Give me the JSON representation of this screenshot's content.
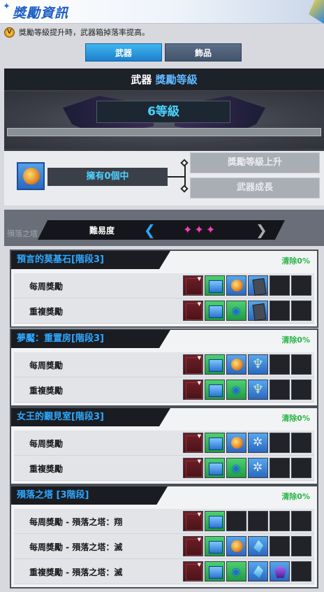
{
  "header": {
    "title": "獎勵資訊",
    "star_icon": "sparkle-icon"
  },
  "notice": {
    "text": "獎勵等級提升時，武器箱掉落率提高。",
    "icon": "medal-icon"
  },
  "tabs": [
    {
      "label": "武器",
      "active": true
    },
    {
      "label": "飾品",
      "active": false
    }
  ],
  "grade": {
    "head_prefix": "武器",
    "head_highlight": "獎勵等級",
    "level": "6等級",
    "progress": 0,
    "owned": "擁有0個中",
    "upgrade_button": "獎勵等級上升",
    "growth_button": "武器成長"
  },
  "background_label": "殞落之塔",
  "difficulty": {
    "label": "難易度",
    "stars": "✦✦✦",
    "left_arrow": "arrow-left-icon",
    "right_arrow": "arrow-right-icon"
  },
  "sections": [
    {
      "title": "預言的莫基石[階段3]",
      "clear": "清除0%",
      "rows": [
        {
          "label": "每周獎勵",
          "slots": [
            "red",
            "book",
            "orb",
            "card",
            "empty",
            "empty"
          ]
        },
        {
          "label": "重複獎勵",
          "slots": [
            "red",
            "book",
            "eye",
            "card",
            "empty",
            "empty"
          ]
        }
      ]
    },
    {
      "title": "夢魘：重置房[階段3]",
      "clear": "清除0%",
      "rows": [
        {
          "label": "每周獎勵",
          "slots": [
            "red",
            "book",
            "orb",
            "crest",
            "empty",
            "empty"
          ]
        },
        {
          "label": "重複獎勵",
          "slots": [
            "red",
            "book",
            "eye",
            "crest",
            "empty",
            "empty"
          ]
        }
      ]
    },
    {
      "title": "女王的覲見室[階段3]",
      "clear": "清除0%",
      "rows": [
        {
          "label": "每周獎勵",
          "slots": [
            "red",
            "book",
            "orb",
            "spider",
            "empty",
            "empty"
          ]
        },
        {
          "label": "重複獎勵",
          "slots": [
            "red",
            "book",
            "eye",
            "spider",
            "empty",
            "empty"
          ]
        }
      ]
    },
    {
      "title": "殞落之塔 [3階段]",
      "clear": "清除0%",
      "rows": [
        {
          "label": "每周獎勵 - 殞落之塔：翔",
          "slots": [
            "red",
            "book",
            "empty",
            "empty",
            "empty",
            "empty"
          ]
        },
        {
          "label": "每周獎勵 - 殞落之塔：滅",
          "slots": [
            "red",
            "book",
            "orb",
            "shard",
            "empty",
            "empty"
          ]
        },
        {
          "label": "重複獎勵 - 殞落之塔：滅",
          "slots": [
            "red",
            "book",
            "eye",
            "shard",
            "gem",
            "empty"
          ]
        }
      ]
    }
  ],
  "colors": {
    "accent_blue": "#2ea8ff",
    "clear_green": "#2bb64a",
    "level_cyan": "#47d4ff",
    "star_pink": "#ff3ebc"
  }
}
